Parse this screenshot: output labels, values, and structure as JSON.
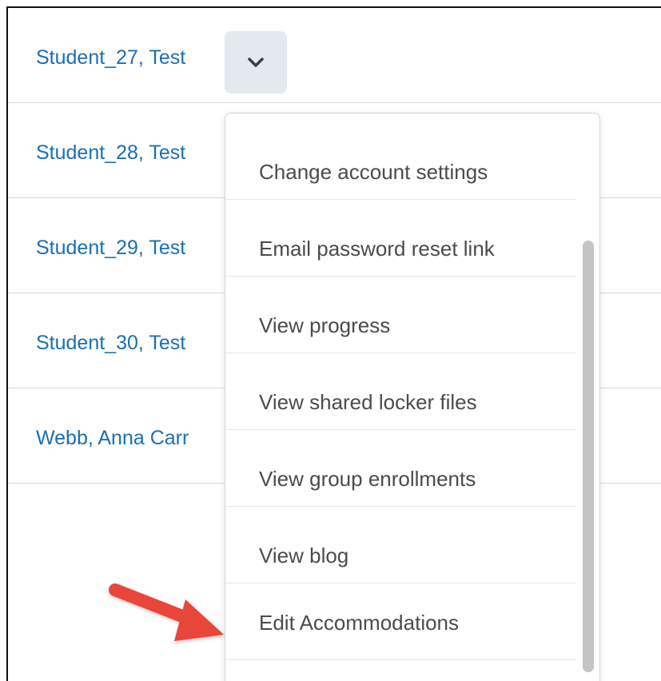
{
  "students": [
    {
      "name": "Student_27, Test"
    },
    {
      "name": "Student_28, Test"
    },
    {
      "name": "Student_29, Test"
    },
    {
      "name": "Student_30, Test"
    },
    {
      "name": "Webb, Anna Carr"
    }
  ],
  "context_menu": {
    "items": [
      {
        "label": "Change account settings"
      },
      {
        "label": "Email password reset link"
      },
      {
        "label": "View progress"
      },
      {
        "label": "View shared locker files"
      },
      {
        "label": "View group enrollments"
      },
      {
        "label": "View blog"
      },
      {
        "label": "Edit Accommodations"
      }
    ]
  },
  "colors": {
    "link": "#1a6fb5",
    "menu_text": "#494c4e",
    "arrow": "#e8443a",
    "button_bg": "#e4e9f0"
  },
  "icons": {
    "dropdown": "chevron-down-icon",
    "annotation": "red-arrow"
  }
}
